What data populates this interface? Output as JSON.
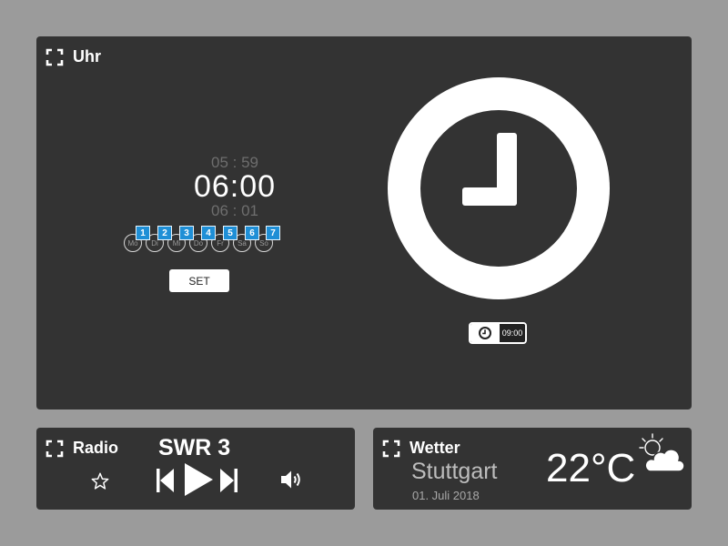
{
  "clock": {
    "title": "Uhr",
    "time_prev": "05 : 59",
    "time_main": "06:00",
    "time_next": "06 : 01",
    "days": [
      "Mo",
      "Di",
      "Mi",
      "Do",
      "Fr",
      "Sa",
      "So"
    ],
    "day_numbers": [
      "1",
      "2",
      "3",
      "4",
      "5",
      "6",
      "7"
    ],
    "set_label": "SET",
    "alarm_time": "09:00",
    "accent_color": "#1f8fd6"
  },
  "radio": {
    "title": "Radio",
    "station": "SWR 3"
  },
  "weather": {
    "title": "Wetter",
    "city": "Stuttgart",
    "date": "01. Juli 2018",
    "temperature": "22°C"
  },
  "icons": {
    "expand": "expand-icon",
    "favorite": "star-icon",
    "previous": "skip-previous-icon",
    "play": "play-icon",
    "next": "skip-next-icon",
    "volume": "volume-icon",
    "alarm_clock": "clock-icon",
    "weather": "partly-cloudy-icon"
  }
}
